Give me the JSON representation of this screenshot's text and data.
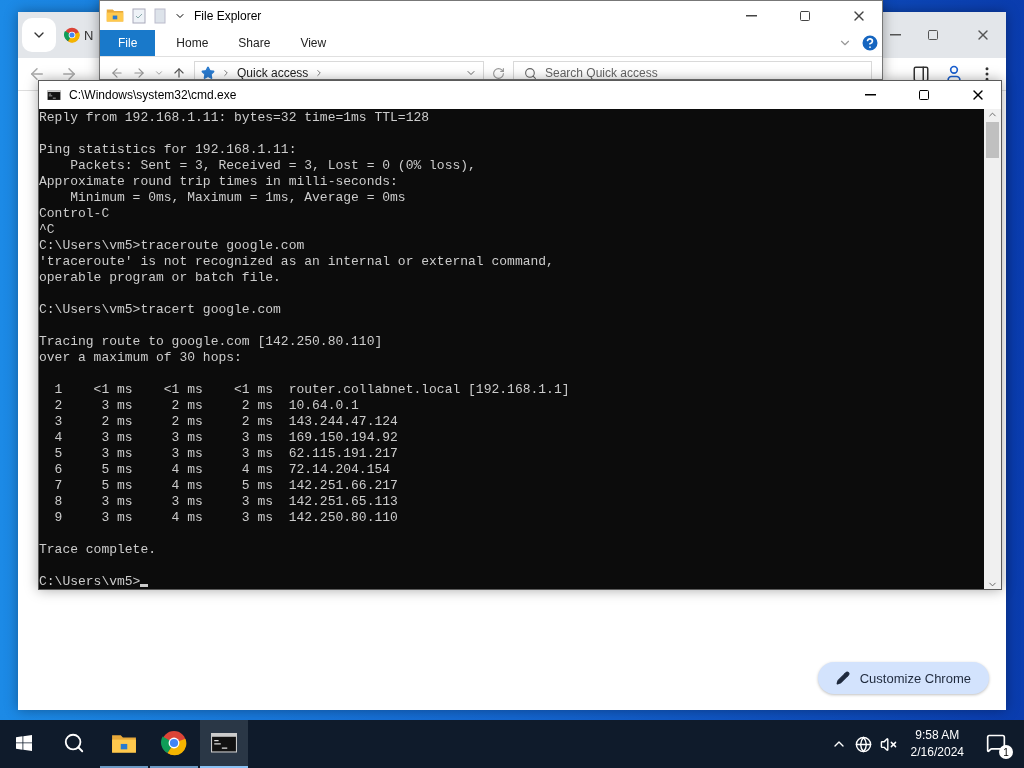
{
  "chrome_window": {
    "tab_title": "N",
    "customize_button": "Customize Chrome"
  },
  "explorer_window": {
    "title": "File Explorer",
    "ribbon_tabs": [
      {
        "label": "File",
        "selected": true
      },
      {
        "label": "Home",
        "selected": false
      },
      {
        "label": "Share",
        "selected": false
      },
      {
        "label": "View",
        "selected": false
      }
    ],
    "address": "Quick access",
    "search": {
      "placeholder": "Search Quick access"
    }
  },
  "cmd_window": {
    "title": "C:\\Windows\\system32\\cmd.exe",
    "blocks": [
      [
        "Reply from 192.168.1.11: bytes=32 time=1ms TTL=128"
      ],
      [
        "Ping statistics for 192.168.1.11:",
        "    Packets: Sent = 3, Received = 3, Lost = 0 (0% loss),",
        "Approximate round trip times in milli-seconds:",
        "    Minimum = 0ms, Maximum = 1ms, Average = 0ms",
        "Control-C",
        "^C",
        "C:\\Users\\vm5>traceroute google.com",
        "'traceroute' is not recognized as an internal or external command,",
        "operable program or batch file."
      ],
      [
        "C:\\Users\\vm5>tracert google.com"
      ],
      [
        "Tracing route to google.com [142.250.80.110]",
        "over a maximum of 30 hops:"
      ],
      [
        "  1    <1 ms    <1 ms    <1 ms  router.collabnet.local [192.168.1.1]",
        "  2     3 ms     2 ms     2 ms  10.64.0.1",
        "  3     2 ms     2 ms     2 ms  143.244.47.124",
        "  4     3 ms     3 ms     3 ms  169.150.194.92",
        "  5     3 ms     3 ms     3 ms  62.115.191.217",
        "  6     5 ms     4 ms     4 ms  72.14.204.154",
        "  7     5 ms     4 ms     5 ms  142.251.66.217",
        "  8     3 ms     3 ms     3 ms  142.251.65.113",
        "  9     3 ms     4 ms     3 ms  142.250.80.110"
      ],
      [
        "Trace complete."
      ],
      [
        "C:\\Users\\vm5>"
      ]
    ]
  },
  "taskbar": {
    "apps": [
      {
        "kind": "explorer",
        "selected": false
      },
      {
        "kind": "chrome",
        "selected": false
      },
      {
        "kind": "terminal",
        "selected": true
      }
    ],
    "time": "9:58 AM",
    "date": "2/16/2024",
    "notifications": "1"
  }
}
